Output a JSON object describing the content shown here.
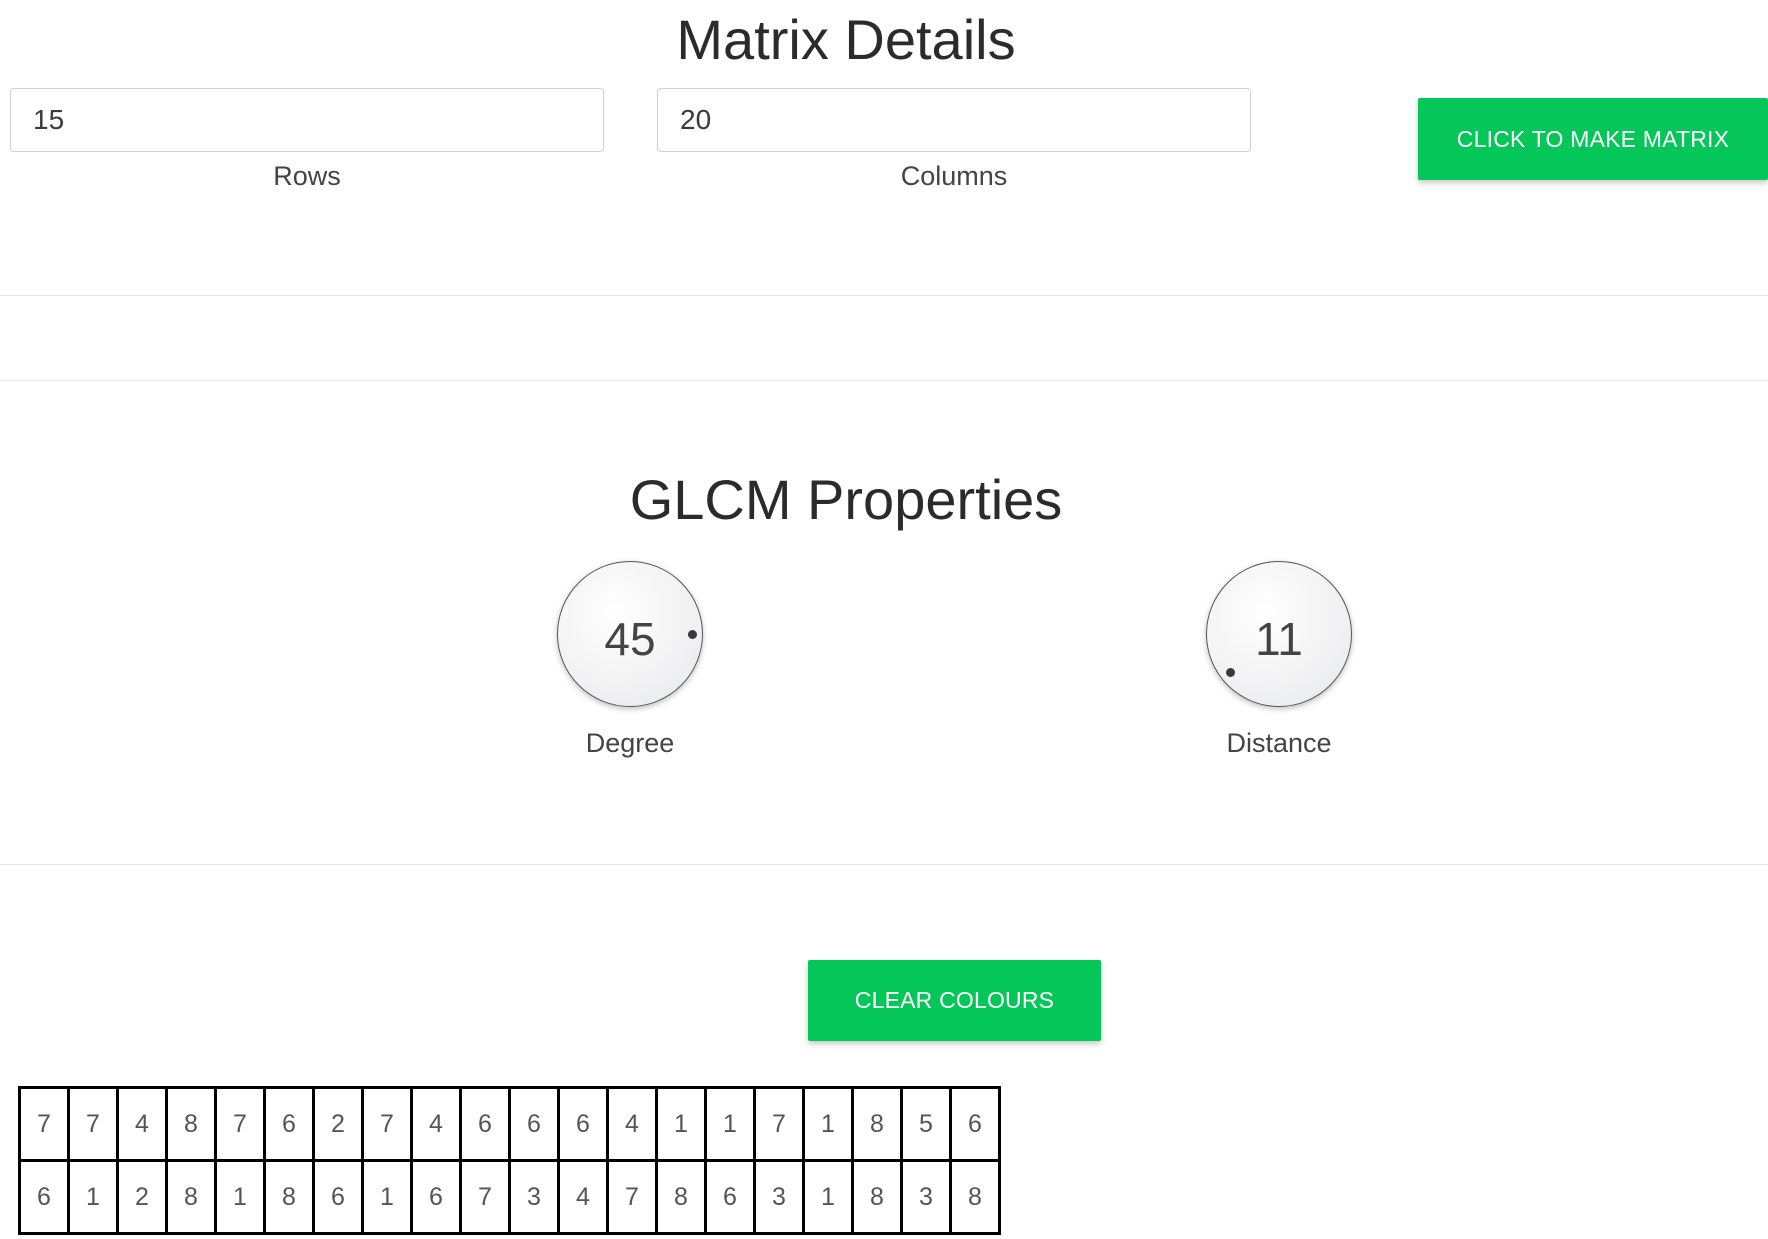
{
  "matrix_details": {
    "title": "Matrix Details",
    "rows_value": "15",
    "rows_label": "Rows",
    "columns_value": "20",
    "columns_label": "Columns",
    "make_matrix_label": "CLICK TO MAKE MATRIX"
  },
  "glcm": {
    "title": "GLCM Properties",
    "degree": {
      "value": "45",
      "label": "Degree"
    },
    "distance": {
      "value": "11",
      "label": "Distance"
    }
  },
  "clear_colours_label": "CLEAR COLOURS",
  "matrix": [
    [
      "7",
      "7",
      "4",
      "8",
      "7",
      "6",
      "2",
      "7",
      "4",
      "6",
      "6",
      "6",
      "4",
      "1",
      "1",
      "7",
      "1",
      "8",
      "5",
      "6"
    ],
    [
      "6",
      "1",
      "2",
      "8",
      "1",
      "8",
      "6",
      "1",
      "6",
      "7",
      "3",
      "4",
      "7",
      "8",
      "6",
      "3",
      "1",
      "8",
      "3",
      "8"
    ]
  ],
  "colors": {
    "accent": "#05c759",
    "divider": "#e2e2e2",
    "grid_border": "#000000"
  }
}
